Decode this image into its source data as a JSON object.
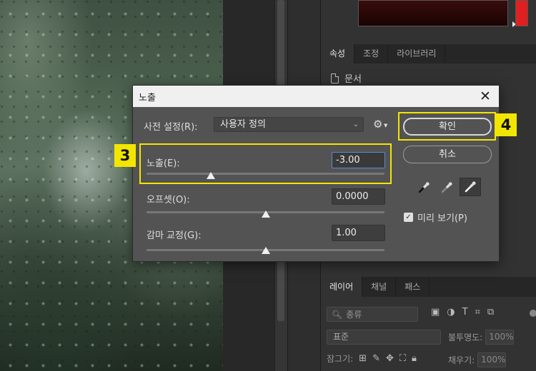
{
  "dialog": {
    "title": "노출",
    "close_glyph": "✕",
    "preset_label": "사전 설정(R):",
    "preset_value": "사용자 정의",
    "gear_icon": "gear-icon",
    "exposure": {
      "label": "노출(E):",
      "value": "-3.00",
      "slider_fraction": 0.27
    },
    "offset": {
      "label": "오프셋(O):",
      "value": "0.0000",
      "slider_fraction": 0.5
    },
    "gamma": {
      "label": "감마 교정(G):",
      "value": "1.00",
      "slider_fraction": 0.5
    },
    "ok_label": "확인",
    "cancel_label": "취소",
    "droppers": [
      "black-point-eyedropper-icon",
      "gray-point-eyedropper-icon",
      "white-point-eyedropper-icon"
    ],
    "preview_label": "미리 보기(P)",
    "preview_checked": true
  },
  "annotations": {
    "step3": "3",
    "step4": "4",
    "highlight_color": "#f2e600"
  },
  "right_panel": {
    "tabs": [
      "속성",
      "조정",
      "라이브러리"
    ],
    "active_tab": "속성",
    "doc_label": "문서",
    "layers_tabs": [
      "레이어",
      "채널",
      "패스"
    ],
    "active_layers_tab": "레이어",
    "search_placeholder": "종류",
    "blend_mode": "표준",
    "opacity_label": "불투명도:",
    "opacity_value": "100%",
    "lock_label": "잠그기:",
    "fill_label": "채우기:",
    "fill_value": "100%"
  }
}
